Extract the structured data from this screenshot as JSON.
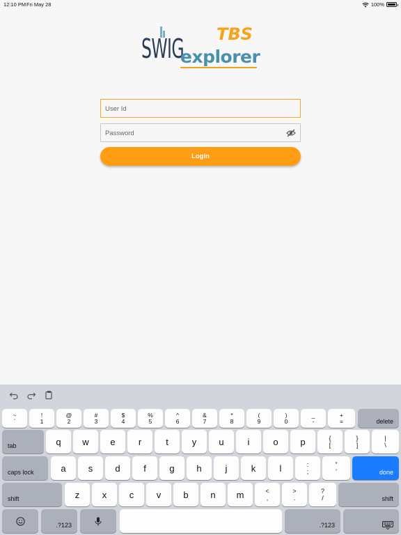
{
  "status_bar": {
    "time": "12:10 PM",
    "date": "Fri May 28",
    "battery": "100%"
  },
  "logo": {
    "swig": "SWIG",
    "tbs": "TBS",
    "explorer": "explorer"
  },
  "form": {
    "userid_placeholder": "User Id",
    "password_placeholder": "Password",
    "login_label": "Login"
  },
  "keyboard": {
    "row1": [
      {
        "top": "~",
        "bot": "`"
      },
      {
        "top": "!",
        "bot": "1"
      },
      {
        "top": "@",
        "bot": "2"
      },
      {
        "top": "#",
        "bot": "3"
      },
      {
        "top": "$",
        "bot": "4"
      },
      {
        "top": "%",
        "bot": "5"
      },
      {
        "top": "^",
        "bot": "6"
      },
      {
        "top": "&",
        "bot": "7"
      },
      {
        "top": "*",
        "bot": "8"
      },
      {
        "top": "(",
        "bot": "9"
      },
      {
        "top": ")",
        "bot": "0"
      },
      {
        "top": "_",
        "bot": "-"
      },
      {
        "top": "+",
        "bot": "="
      }
    ],
    "delete": "delete",
    "tab": "tab",
    "row2": [
      "q",
      "w",
      "e",
      "r",
      "t",
      "y",
      "u",
      "i",
      "o",
      "p"
    ],
    "row2_sym": [
      {
        "top": "{",
        "bot": "["
      },
      {
        "top": "}",
        "bot": "]"
      },
      {
        "top": "|",
        "bot": "\\"
      }
    ],
    "caps": "caps lock",
    "row3": [
      "a",
      "s",
      "d",
      "f",
      "g",
      "h",
      "j",
      "k",
      "l"
    ],
    "row3_sym": [
      {
        "top": ":",
        "bot": ";"
      },
      {
        "top": "”",
        "bot": "’"
      }
    ],
    "done": "done",
    "shift": "shift",
    "row4": [
      "z",
      "x",
      "c",
      "v",
      "b",
      "n",
      "m"
    ],
    "row4_sym": [
      {
        "top": "<",
        "bot": ","
      },
      {
        "top": ">",
        "bot": "."
      },
      {
        "top": "?",
        "bot": "/"
      }
    ],
    "numbers": ".?123"
  },
  "colors": {
    "accent": "#ff9d14",
    "done": "#1a7cfe"
  }
}
